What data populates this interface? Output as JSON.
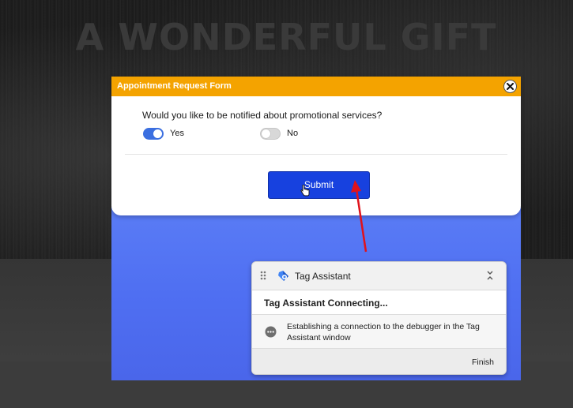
{
  "hero": {
    "title": "A WONDERFUL GIFT"
  },
  "modal": {
    "title": "Appointment Request Form",
    "question": "Would you like to be notified about promotional services?",
    "options": [
      {
        "label": "Yes",
        "state": "on"
      },
      {
        "label": "No",
        "state": "off"
      }
    ],
    "submit_label": "Submit"
  },
  "tag_assistant": {
    "title": "Tag Assistant",
    "status_heading": "Tag Assistant Connecting...",
    "message": "Establishing a connection to the debugger in the Tag Assistant window",
    "finish_label": "Finish"
  },
  "colors": {
    "header_orange": "#f4a300",
    "submit_blue": "#1741df",
    "panel_blue": "#4f6ff2",
    "toggle_on": "#3b6fe0",
    "annotation_arrow": "#e0121b"
  },
  "icons": {
    "close": "close-icon",
    "cursor": "hand-pointer-icon",
    "drag": "drag-handle-icon",
    "logo": "tag-assistant-logo-icon",
    "collapse": "chevron-collapse-icon",
    "status": "more-horizontal-icon",
    "annotation": "red-arrow-icon"
  }
}
